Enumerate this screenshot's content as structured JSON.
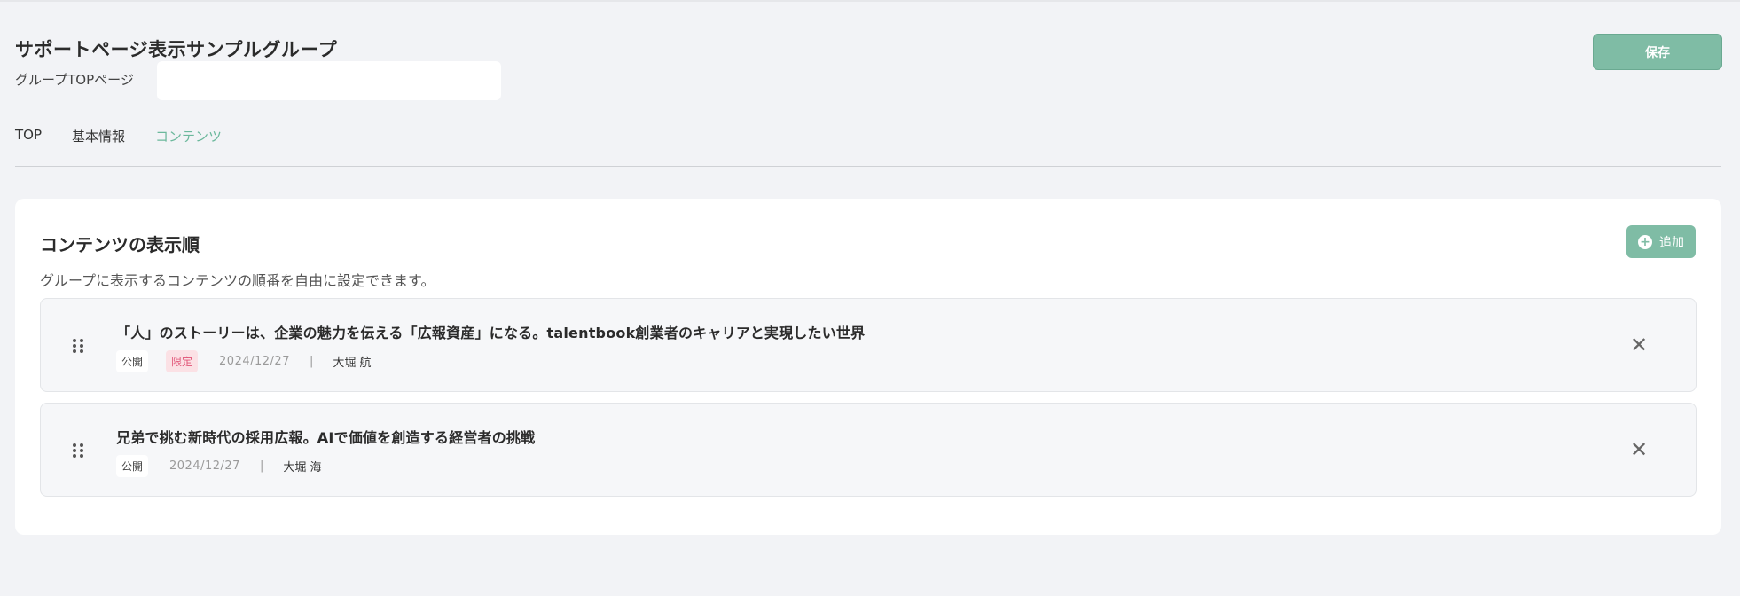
{
  "header": {
    "title": "サポートページ表示サンプルグループ",
    "sub_label": "グループTOPページ",
    "url_input_value": "",
    "save_label": "保存"
  },
  "tabs": [
    {
      "label": "TOP",
      "active": false
    },
    {
      "label": "基本情報",
      "active": false
    },
    {
      "label": "コンテンツ",
      "active": true
    }
  ],
  "panel": {
    "title": "コンテンツの表示順",
    "description": "グループに表示するコンテンツの順番を自由に設定できます。",
    "add_label": "追加",
    "add_icon": "plus-circle-icon"
  },
  "items": [
    {
      "title": "「人」のストーリーは、企業の魅力を伝える「広報資産」になる。talentbook創業者のキャリアと実現したい世界",
      "status": "公開",
      "limited": "限定",
      "date": "2024/12/27",
      "separator": "|",
      "author": "大堀 航"
    },
    {
      "title": "兄弟で挑む新時代の採用広報。AIで価値を創造する経営者の挑戦",
      "status": "公開",
      "date": "2024/12/27",
      "separator": "|",
      "author": "大堀 海"
    }
  ],
  "colors": {
    "accent": "#7fbca5",
    "active_tab": "#6cb89c",
    "limited_badge_text": "#e05275",
    "limited_badge_bg": "#fbe1e5",
    "page_bg": "#f2f3f6"
  }
}
